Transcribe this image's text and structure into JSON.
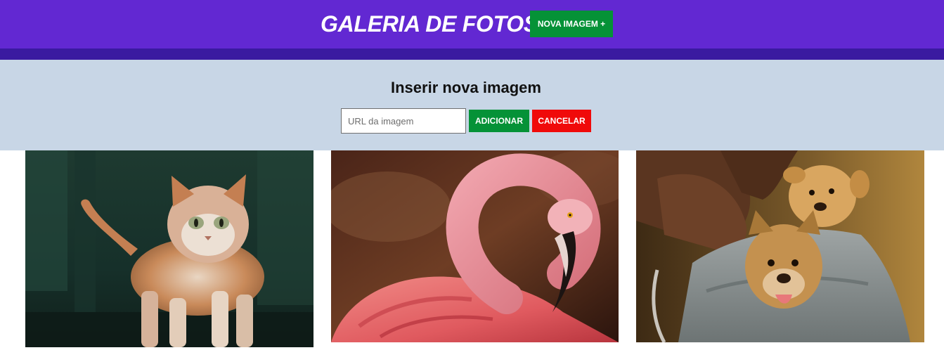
{
  "header": {
    "title": "GALERIA DE FOTOS",
    "new_image_button": "NOVA IMAGEM +"
  },
  "form": {
    "title": "Inserir nova imagem",
    "url_input": {
      "placeholder": "URL da imagem",
      "value": ""
    },
    "add_button": "ADICIONAR",
    "cancel_button": "CANCELAR"
  },
  "gallery": {
    "images": [
      {
        "subject": "cat"
      },
      {
        "subject": "flamingo"
      },
      {
        "subject": "puppies"
      }
    ]
  },
  "colors": {
    "header_bg": "#6228d2",
    "header_band": "#3a1aa0",
    "form_bg": "#c8d6e6",
    "add_green": "#059237",
    "cancel_red": "#f00a0a"
  }
}
